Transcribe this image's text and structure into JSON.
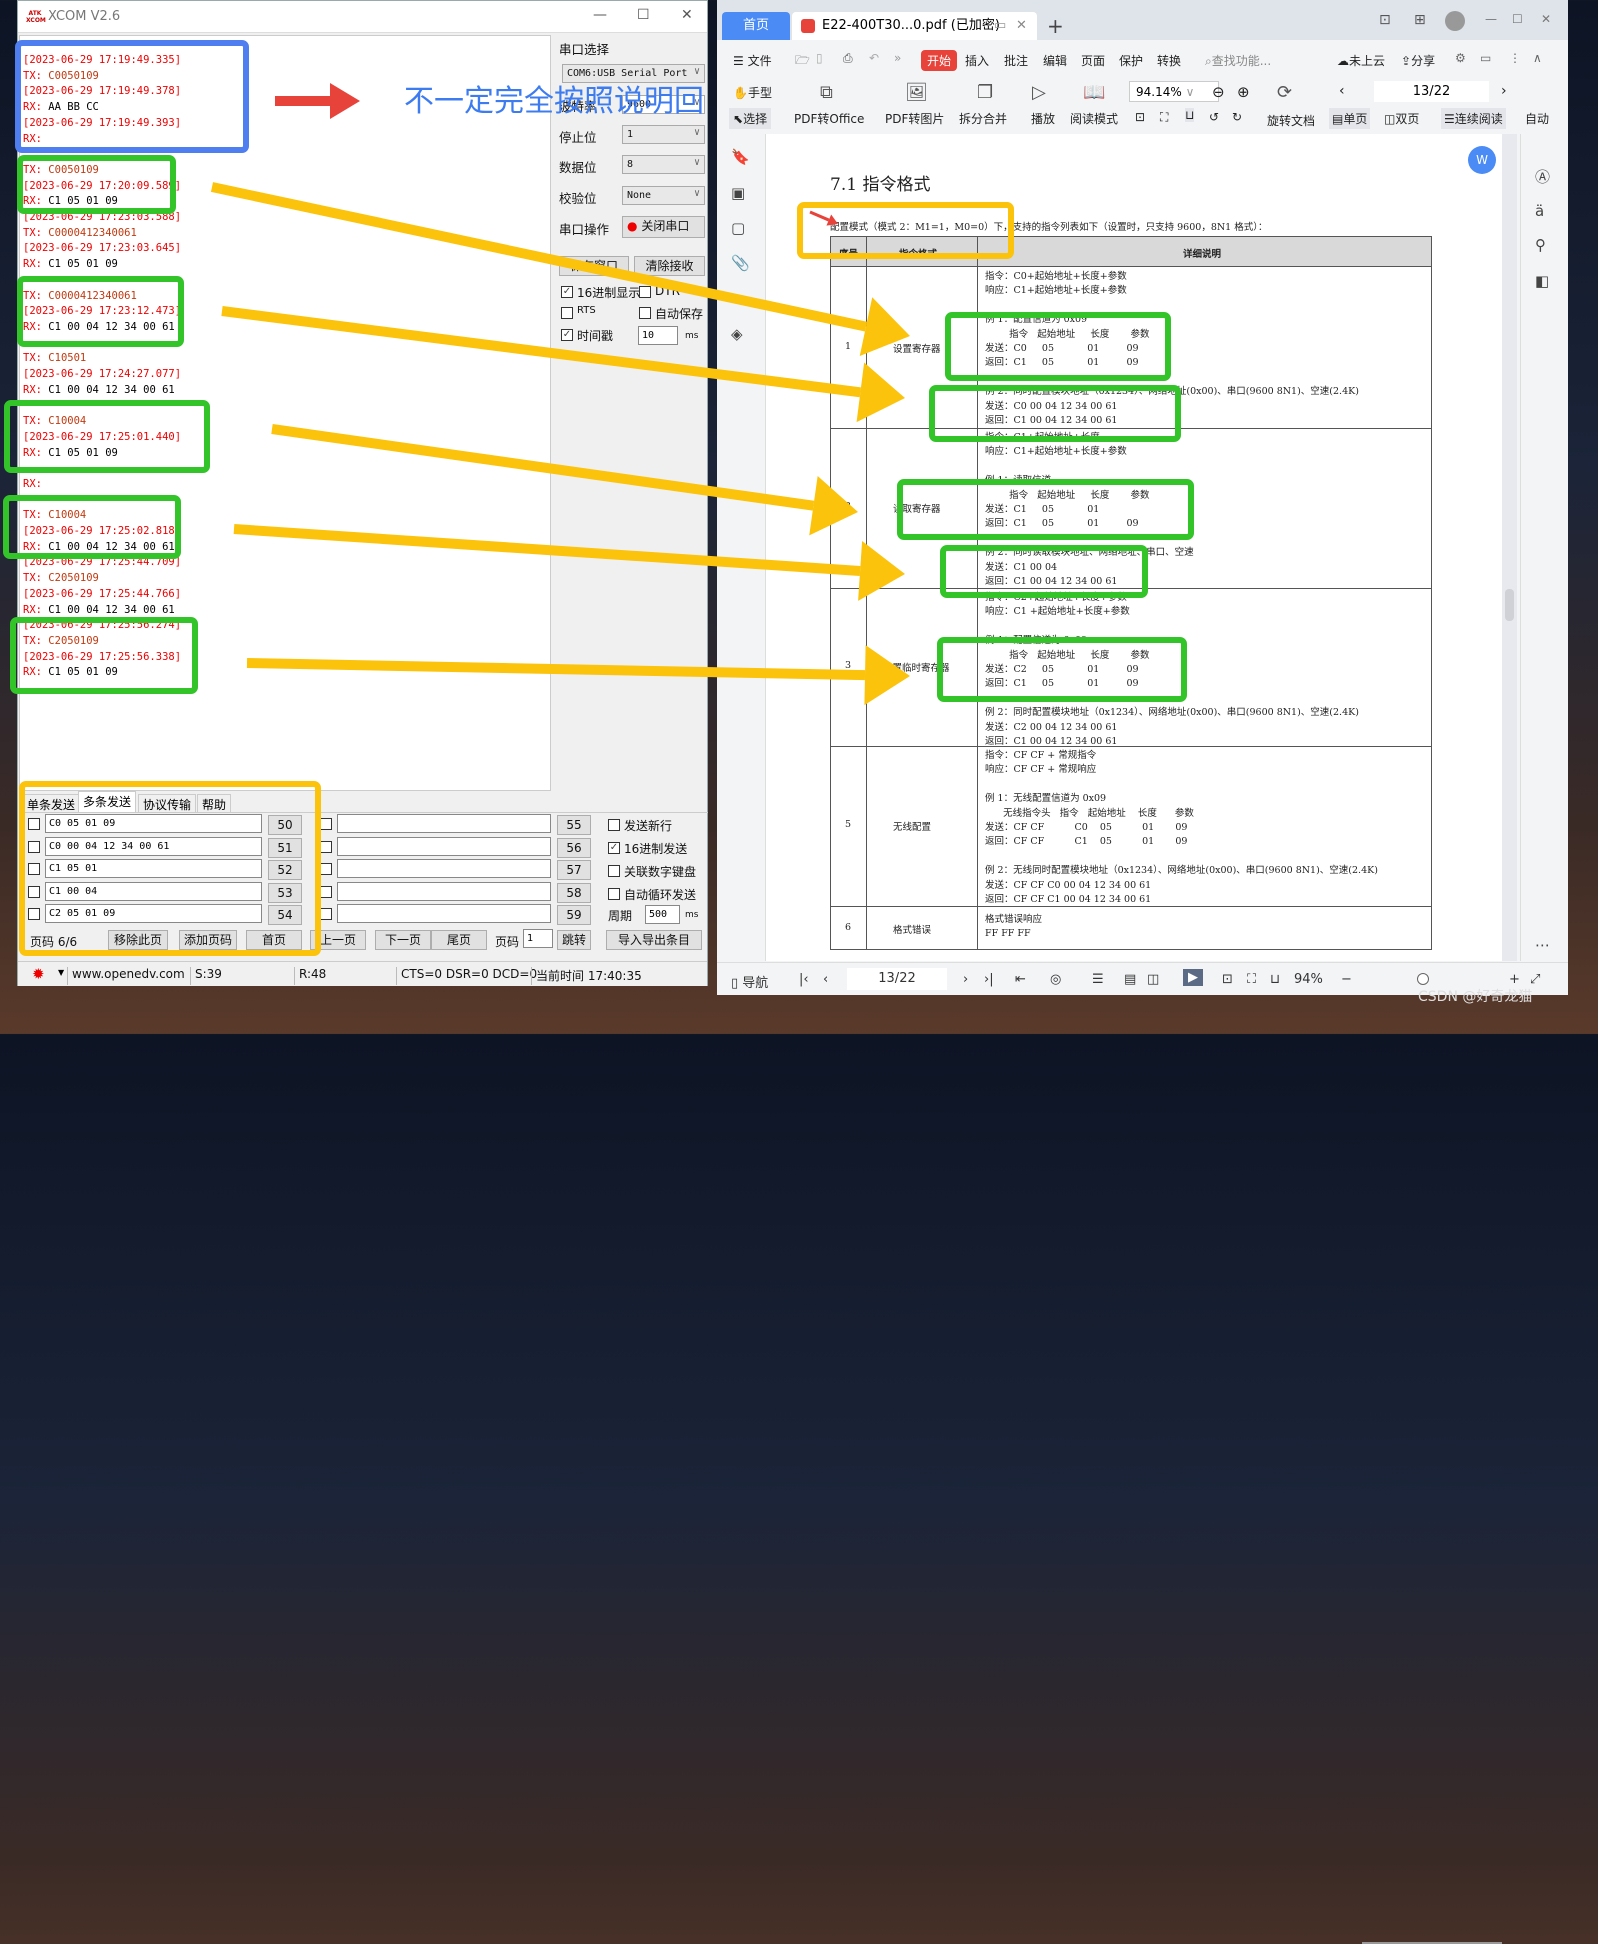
{
  "xcom": {
    "title": "XCOM V2.6",
    "logo": "ATK",
    "log": [
      {
        "text": "[2023-06-29 17:19:49.335]",
        "kind": "ts"
      },
      {
        "label": "TX: ",
        "text": "C0050109",
        "kind": "tx"
      },
      {
        "text": "[2023-06-29 17:19:49.378]",
        "kind": "ts"
      },
      {
        "label": "RX: ",
        "text": "AA BB CC",
        "kind": "rx"
      },
      {
        "text": "[2023-06-29 17:19:49.393]",
        "kind": "ts"
      },
      {
        "label": "RX:",
        "text": "",
        "kind": "rx"
      },
      {
        "text": "",
        "kind": "ts"
      },
      {
        "label": "TX: ",
        "text": "C0050109",
        "kind": "tx"
      },
      {
        "text": "[2023-06-29 17:20:09.589]",
        "kind": "ts"
      },
      {
        "label": "RX: ",
        "text": "C1 05 01 09",
        "kind": "rx"
      },
      {
        "text": "[2023-06-29 17:23:03.588]",
        "kind": "ts"
      },
      {
        "label": "TX: ",
        "text": "C0000412340061",
        "kind": "tx"
      },
      {
        "text": "[2023-06-29 17:23:03.645]",
        "kind": "ts"
      },
      {
        "label": "RX: ",
        "text": "C1 05 01 09",
        "kind": "rx"
      },
      {
        "text": "",
        "kind": "ts"
      },
      {
        "label": "TX: ",
        "text": "C0000412340061",
        "kind": "tx"
      },
      {
        "text": "[2023-06-29 17:23:12.473]",
        "kind": "ts"
      },
      {
        "label": "RX: ",
        "text": "C1 00 04 12 34 00 61",
        "kind": "rx"
      },
      {
        "text": "",
        "kind": "ts"
      },
      {
        "label": "TX: ",
        "text": "C10501",
        "kind": "tx"
      },
      {
        "text": "[2023-06-29 17:24:27.077]",
        "kind": "ts"
      },
      {
        "label": "RX: ",
        "text": "C1 00 04 12 34 00 61",
        "kind": "rx"
      },
      {
        "text": "",
        "kind": "ts"
      },
      {
        "label": "TX: ",
        "text": "C10004",
        "kind": "tx"
      },
      {
        "text": "[2023-06-29 17:25:01.440]",
        "kind": "ts"
      },
      {
        "label": "RX: ",
        "text": "C1 05 01 09",
        "kind": "rx"
      },
      {
        "text": "",
        "kind": "ts"
      },
      {
        "label": "RX:",
        "text": "",
        "kind": "rx"
      },
      {
        "text": "",
        "kind": "ts"
      },
      {
        "label": "TX: ",
        "text": "C10004",
        "kind": "tx"
      },
      {
        "text": "[2023-06-29 17:25:02.818]",
        "kind": "ts"
      },
      {
        "label": "RX: ",
        "text": "C1 00 04 12 34 00 61",
        "kind": "rx"
      },
      {
        "text": "[2023-06-29 17:25:44.709]",
        "kind": "ts"
      },
      {
        "label": "TX: ",
        "text": "C2050109",
        "kind": "tx"
      },
      {
        "text": "[2023-06-29 17:25:44.766]",
        "kind": "ts"
      },
      {
        "label": "RX: ",
        "text": "C1 00 04 12 34 00 61",
        "kind": "rx"
      },
      {
        "text": "[2023-06-29 17:25:56.274]",
        "kind": "ts"
      },
      {
        "label": "TX: ",
        "text": "C2050109",
        "kind": "tx"
      },
      {
        "text": "[2023-06-29 17:25:56.338]",
        "kind": "ts"
      },
      {
        "label": "RX: ",
        "text": "C1 05 01 09",
        "kind": "rx"
      }
    ],
    "settings": {
      "port_label": "串口选择",
      "port_value": "COM6:USB Serial Port",
      "baud_label": "波特率",
      "baud_value": "9600",
      "stop_label": "停止位",
      "stop_value": "1",
      "data_label": "数据位",
      "data_value": "8",
      "parity_label": "校验位",
      "parity_value": "None",
      "op_label": "串口操作",
      "op_button": "关闭串口",
      "save_button": "保存窗口",
      "clear_button": "清除接收",
      "hex_display": "16进制显示",
      "hex_display_checked": true,
      "dtr": "DTR",
      "dtr_checked": false,
      "rts": "RTS",
      "rts_checked": false,
      "autosave": "自动保存",
      "autosave_checked": false,
      "timestamp": "时间戳",
      "timestamp_checked": true,
      "timestamp_value": "10",
      "timestamp_unit": "ms"
    },
    "tabs": [
      "单条发送",
      "多条发送",
      "协议传输",
      "帮助"
    ],
    "active_tab": "多条发送",
    "send_rows_left": [
      {
        "value": "C0 05 01 09",
        "button": "50"
      },
      {
        "value": "C0 00 04 12 34 00 61",
        "button": "51"
      },
      {
        "value": "C1 05 01",
        "button": "52"
      },
      {
        "value": "C1 00 04",
        "button": "53"
      },
      {
        "value": "C2 05 01 09",
        "button": "54"
      }
    ],
    "send_rows_right": [
      {
        "value": "",
        "button": "55"
      },
      {
        "value": "",
        "button": "56"
      },
      {
        "value": "",
        "button": "57"
      },
      {
        "value": "",
        "button": "58"
      },
      {
        "value": "",
        "button": "59"
      }
    ],
    "options": [
      {
        "label": "发送新行",
        "checked": false
      },
      {
        "label": "16进制发送",
        "checked": true
      },
      {
        "label": "关联数字键盘",
        "checked": false
      },
      {
        "label": "自动循环发送",
        "checked": false
      }
    ],
    "period_label": "周期",
    "period_value": "500",
    "period_unit": "ms",
    "pager": {
      "page_label": "页码 6/6",
      "remove": "移除此页",
      "add": "添加页码",
      "first": "首页",
      "prev": "上一页",
      "next": "下一页",
      "last": "尾页",
      "goto_label": "页码",
      "goto_value": "1",
      "jump": "跳转",
      "import_export": "导入导出条目"
    },
    "status": {
      "url": "www.openedv.com",
      "sent": "S:39",
      "received": "R:48",
      "lines": "CTS=0 DSR=0 DCD=0",
      "time": "当前时间 17:40:35"
    }
  },
  "annotation_note": "不一定完全按照说明回",
  "pdf": {
    "home_tab": "首页",
    "doc_tab": "E22-400T30...0.pdf (已加密)",
    "menu": {
      "file": "文件",
      "start": "开始",
      "insert": "插入",
      "comment": "批注",
      "edit": "编辑",
      "page": "页面",
      "protect": "保护",
      "convert": "转换",
      "search": "查找功能...",
      "cloud": "未上云",
      "share": "分享"
    },
    "tools": {
      "hand": "手型",
      "select": "选择",
      "pdf_office": "PDF转Office",
      "pdf_image": "PDF转图片",
      "split_merge": "拆分合并",
      "play": "播放",
      "read_mode": "阅读模式",
      "zoom": "94.14%",
      "rotate": "旋转文档",
      "single": "单页",
      "double": "双页",
      "continuous": "连续阅读",
      "auto": "自动"
    },
    "page_indicator": "13/22",
    "heading": "7.1  指令格式",
    "intro": "配置模式（模式 2：M1=1，M0=0）下，支持的指令列表如下（设置时，只支持 9600，8N1 格式）：",
    "table": {
      "headers": [
        "序号",
        "指令格式",
        "详细说明"
      ],
      "rows": [
        {
          "no": "1",
          "name": "设置寄存器",
          "lines": [
            "指令：C0+起始地址+长度+参数",
            "响应：C1+起始地址+长度+参数",
            "",
            "例 1：配置信道为 0x09",
            "        指令   起始地址     长度       参数",
            "发送：C0     05           01         09",
            "返回：C1     05           01         09",
            "",
            "例 2：同时配置模块地址（0x1234）、网络地址(0x00)、串口(9600 8N1)、空速(2.4K)",
            "发送：C0 00 04 12 34 00 61",
            "返回：C1 00 04 12 34 00 61"
          ]
        },
        {
          "no": "2",
          "name": "读取寄存器",
          "lines": [
            "指令：C1+起始地址+长度",
            "响应：C1+起始地址+长度+参数",
            "",
            "例 1：读取信道",
            "        指令   起始地址     长度       参数",
            "发送：C1     05           01",
            "返回：C1     05           01         09",
            "",
            "例 2：同时读取模块地址、网络地址、串口、空速",
            "发送：C1 00 04",
            "返回：C1 00 04 12 34 00 61"
          ]
        },
        {
          "no": "3",
          "name": "设置临时寄存器",
          "lines": [
            "指令：C2+起始地址+长度+参数",
            "响应：C1 +起始地址+长度+参数",
            "",
            "例 1：配置信道为 0x09",
            "        指令   起始地址     长度       参数",
            "发送：C2     05           01         09",
            "返回：C1     05           01         09",
            "",
            "例 2：同时配置模块地址（0x1234）、网络地址(0x00)、串口(9600 8N1)、空速(2.4K)",
            "发送：C2 00 04 12 34 00 61",
            "返回：C1 00 04 12 34 00 61"
          ]
        },
        {
          "no": "5",
          "name": "无线配置",
          "lines": [
            "指令：CF CF + 常规指令",
            "响应：CF CF + 常规响应",
            "",
            "例 1：无线配置信道为 0x09",
            "      无线指令头   指令   起始地址    长度      参数",
            "发送：CF CF          C0    05          01       09",
            "返回：CF CF          C1    05          01       09",
            "",
            "例 2：无线同时配置模块地址（0x1234）、网络地址(0x00)、串口(9600 8N1)、空速(2.4K)",
            "发送：CF CF C0 00 04 12 34 00 61",
            "返回：CF CF C1 00 04 12 34 00 61"
          ]
        },
        {
          "no": "6",
          "name": "格式错误",
          "lines": [
            "格式错误响应",
            "FF FF FF"
          ]
        }
      ]
    },
    "status": {
      "nav": "导航",
      "page": "13/22",
      "zoom": "94%"
    }
  },
  "watermark": "CSDN @好奇龙猫",
  "colors": {
    "annotation_green": "#33c42a",
    "annotation_orange": "#fbc30b",
    "annotation_blue": "#4f7ef0",
    "annotation_red": "#e8433a",
    "wps_blue": "#4b8bf5",
    "log_timestamp": "#e00000",
    "log_tx": "#c03a10"
  }
}
